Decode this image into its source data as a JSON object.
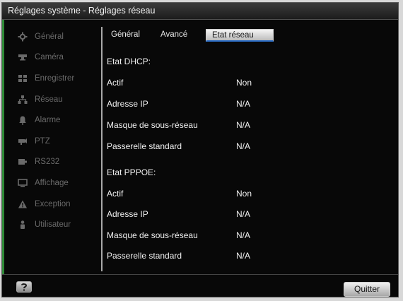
{
  "window": {
    "title": "Réglages système - Réglages réseau"
  },
  "sidebar": {
    "items": [
      {
        "label": "Général",
        "icon": "gear-icon"
      },
      {
        "label": "Caméra",
        "icon": "camera-icon"
      },
      {
        "label": "Enregistrer",
        "icon": "record-icon"
      },
      {
        "label": "Réseau",
        "icon": "network-icon"
      },
      {
        "label": "Alarme",
        "icon": "alarm-icon"
      },
      {
        "label": "PTZ",
        "icon": "ptz-icon"
      },
      {
        "label": "RS232",
        "icon": "serial-port-icon"
      },
      {
        "label": "Affichage",
        "icon": "monitor-icon"
      },
      {
        "label": "Exception",
        "icon": "warning-icon"
      },
      {
        "label": "Utilisateur",
        "icon": "user-icon"
      }
    ]
  },
  "tabs": [
    {
      "label": "Général",
      "active": false
    },
    {
      "label": "Avancé",
      "active": false
    },
    {
      "label": "Etat réseau",
      "active": true
    }
  ],
  "dhcp": {
    "title": "Etat DHCP:",
    "rows": [
      {
        "key": "Actif",
        "value": "Non"
      },
      {
        "key": "Adresse IP",
        "value": "N/A"
      },
      {
        "key": "Masque de sous-réseau",
        "value": "N/A"
      },
      {
        "key": "Passerelle standard",
        "value": "N/A"
      }
    ]
  },
  "pppoe": {
    "title": "Etat PPPOE:",
    "rows": [
      {
        "key": "Actif",
        "value": "Non"
      },
      {
        "key": "Adresse IP",
        "value": "N/A"
      },
      {
        "key": "Masque de sous-réseau",
        "value": "N/A"
      },
      {
        "key": "Passerelle standard",
        "value": "N/A"
      }
    ]
  },
  "footer": {
    "help_icon": "help-icon",
    "quit_label": "Quitter"
  },
  "colors": {
    "background": "#080808",
    "accent_green": "#2f8a37",
    "active_tab_underline": "#2b6cc4",
    "sidebar_text": "#6a6a6a",
    "content_text": "#f0f0f0"
  }
}
